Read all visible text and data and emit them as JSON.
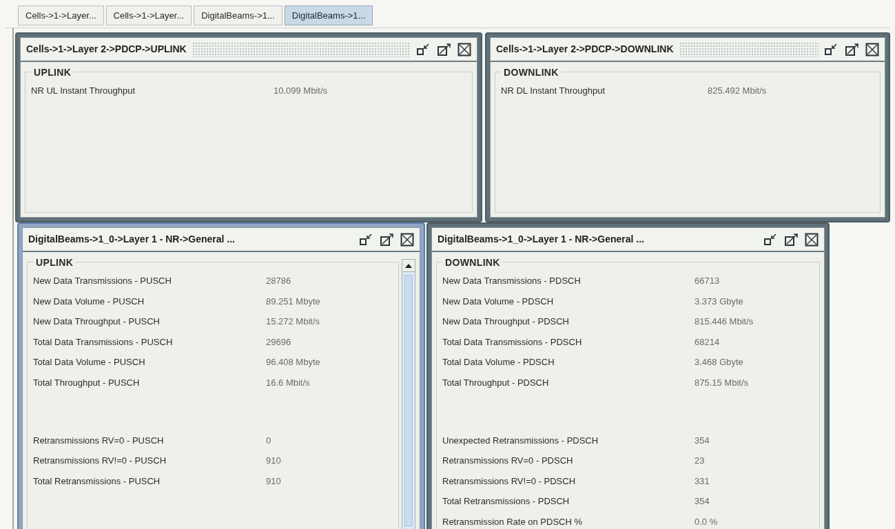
{
  "tabs": [
    {
      "label": "Cells->1->Layer...",
      "selected": false
    },
    {
      "label": "Cells->1->Layer...",
      "selected": false
    },
    {
      "label": "DigitalBeams->1...",
      "selected": false
    },
    {
      "label": "DigitalBeams->1...",
      "selected": true
    }
  ],
  "top_frames": [
    {
      "title": "Cells->1->Layer 2->PDCP->UPLINK",
      "active": false,
      "grip": true,
      "group": {
        "title": "UPLINK",
        "sections": [
          [
            {
              "label": "NR UL Instant Throughput",
              "value": "10.099 Mbit/s"
            }
          ]
        ]
      }
    },
    {
      "title": "Cells->1->Layer 2->PDCP->DOWNLINK",
      "active": false,
      "grip": true,
      "group": {
        "title": "DOWNLINK",
        "sections": [
          [
            {
              "label": "NR DL Instant Throughput",
              "value": "825.492 Mbit/s"
            }
          ]
        ]
      }
    }
  ],
  "bottom_frames": [
    {
      "title": "DigitalBeams->1_0->Layer 1 - NR->General ...",
      "active": true,
      "scrollbar": true,
      "group": {
        "title": "UPLINK",
        "sections": [
          [
            {
              "label": "New Data Transmissions - PUSCH",
              "value": "28786"
            },
            {
              "label": "New Data Volume - PUSCH",
              "value": "89.251 Mbyte"
            },
            {
              "label": "New Data Throughput - PUSCH",
              "value": "15.272 Mbit/s"
            },
            {
              "label": "Total Data Transmissions - PUSCH",
              "value": "29696"
            },
            {
              "label": "Total Data Volume - PUSCH",
              "value": "96.408 Mbyte"
            },
            {
              "label": "Total Throughput - PUSCH",
              "value": "16.6 Mbit/s"
            }
          ],
          [
            {
              "label": "Retransmissions RV=0 - PUSCH",
              "value": "0"
            },
            {
              "label": "Retransmissions RV!=0 - PUSCH",
              "value": "910"
            },
            {
              "label": "Total Retransmissions - PUSCH",
              "value": "910"
            }
          ]
        ]
      }
    },
    {
      "title": "DigitalBeams->1_0->Layer 1 - NR->General ...",
      "active": false,
      "group": {
        "title": "DOWNLINK",
        "sections": [
          [
            {
              "label": "New Data Transmissions - PDSCH",
              "value": "66713"
            },
            {
              "label": "New Data Volume - PDSCH",
              "value": "3.373 Gbyte"
            },
            {
              "label": "New Data Throughput - PDSCH",
              "value": "815.446 Mbit/s"
            },
            {
              "label": "Total Data Transmissions - PDSCH",
              "value": "68214"
            },
            {
              "label": "Total Data Volume - PDSCH",
              "value": "3.468 Gbyte"
            },
            {
              "label": "Total Throughput - PDSCH",
              "value": "875.15 Mbit/s"
            }
          ],
          [
            {
              "label": "Unexpected Retransmissions - PDSCH",
              "value": "354"
            },
            {
              "label": "Retransmissions RV=0 - PDSCH",
              "value": "23"
            },
            {
              "label": "Retransmissions RV!=0 - PDSCH",
              "value": "331"
            },
            {
              "label": "Total Retransmissions - PDSCH",
              "value": "354"
            },
            {
              "label": "Retransmission Rate on PDSCH %",
              "value": "0.0 %"
            }
          ]
        ]
      }
    }
  ]
}
